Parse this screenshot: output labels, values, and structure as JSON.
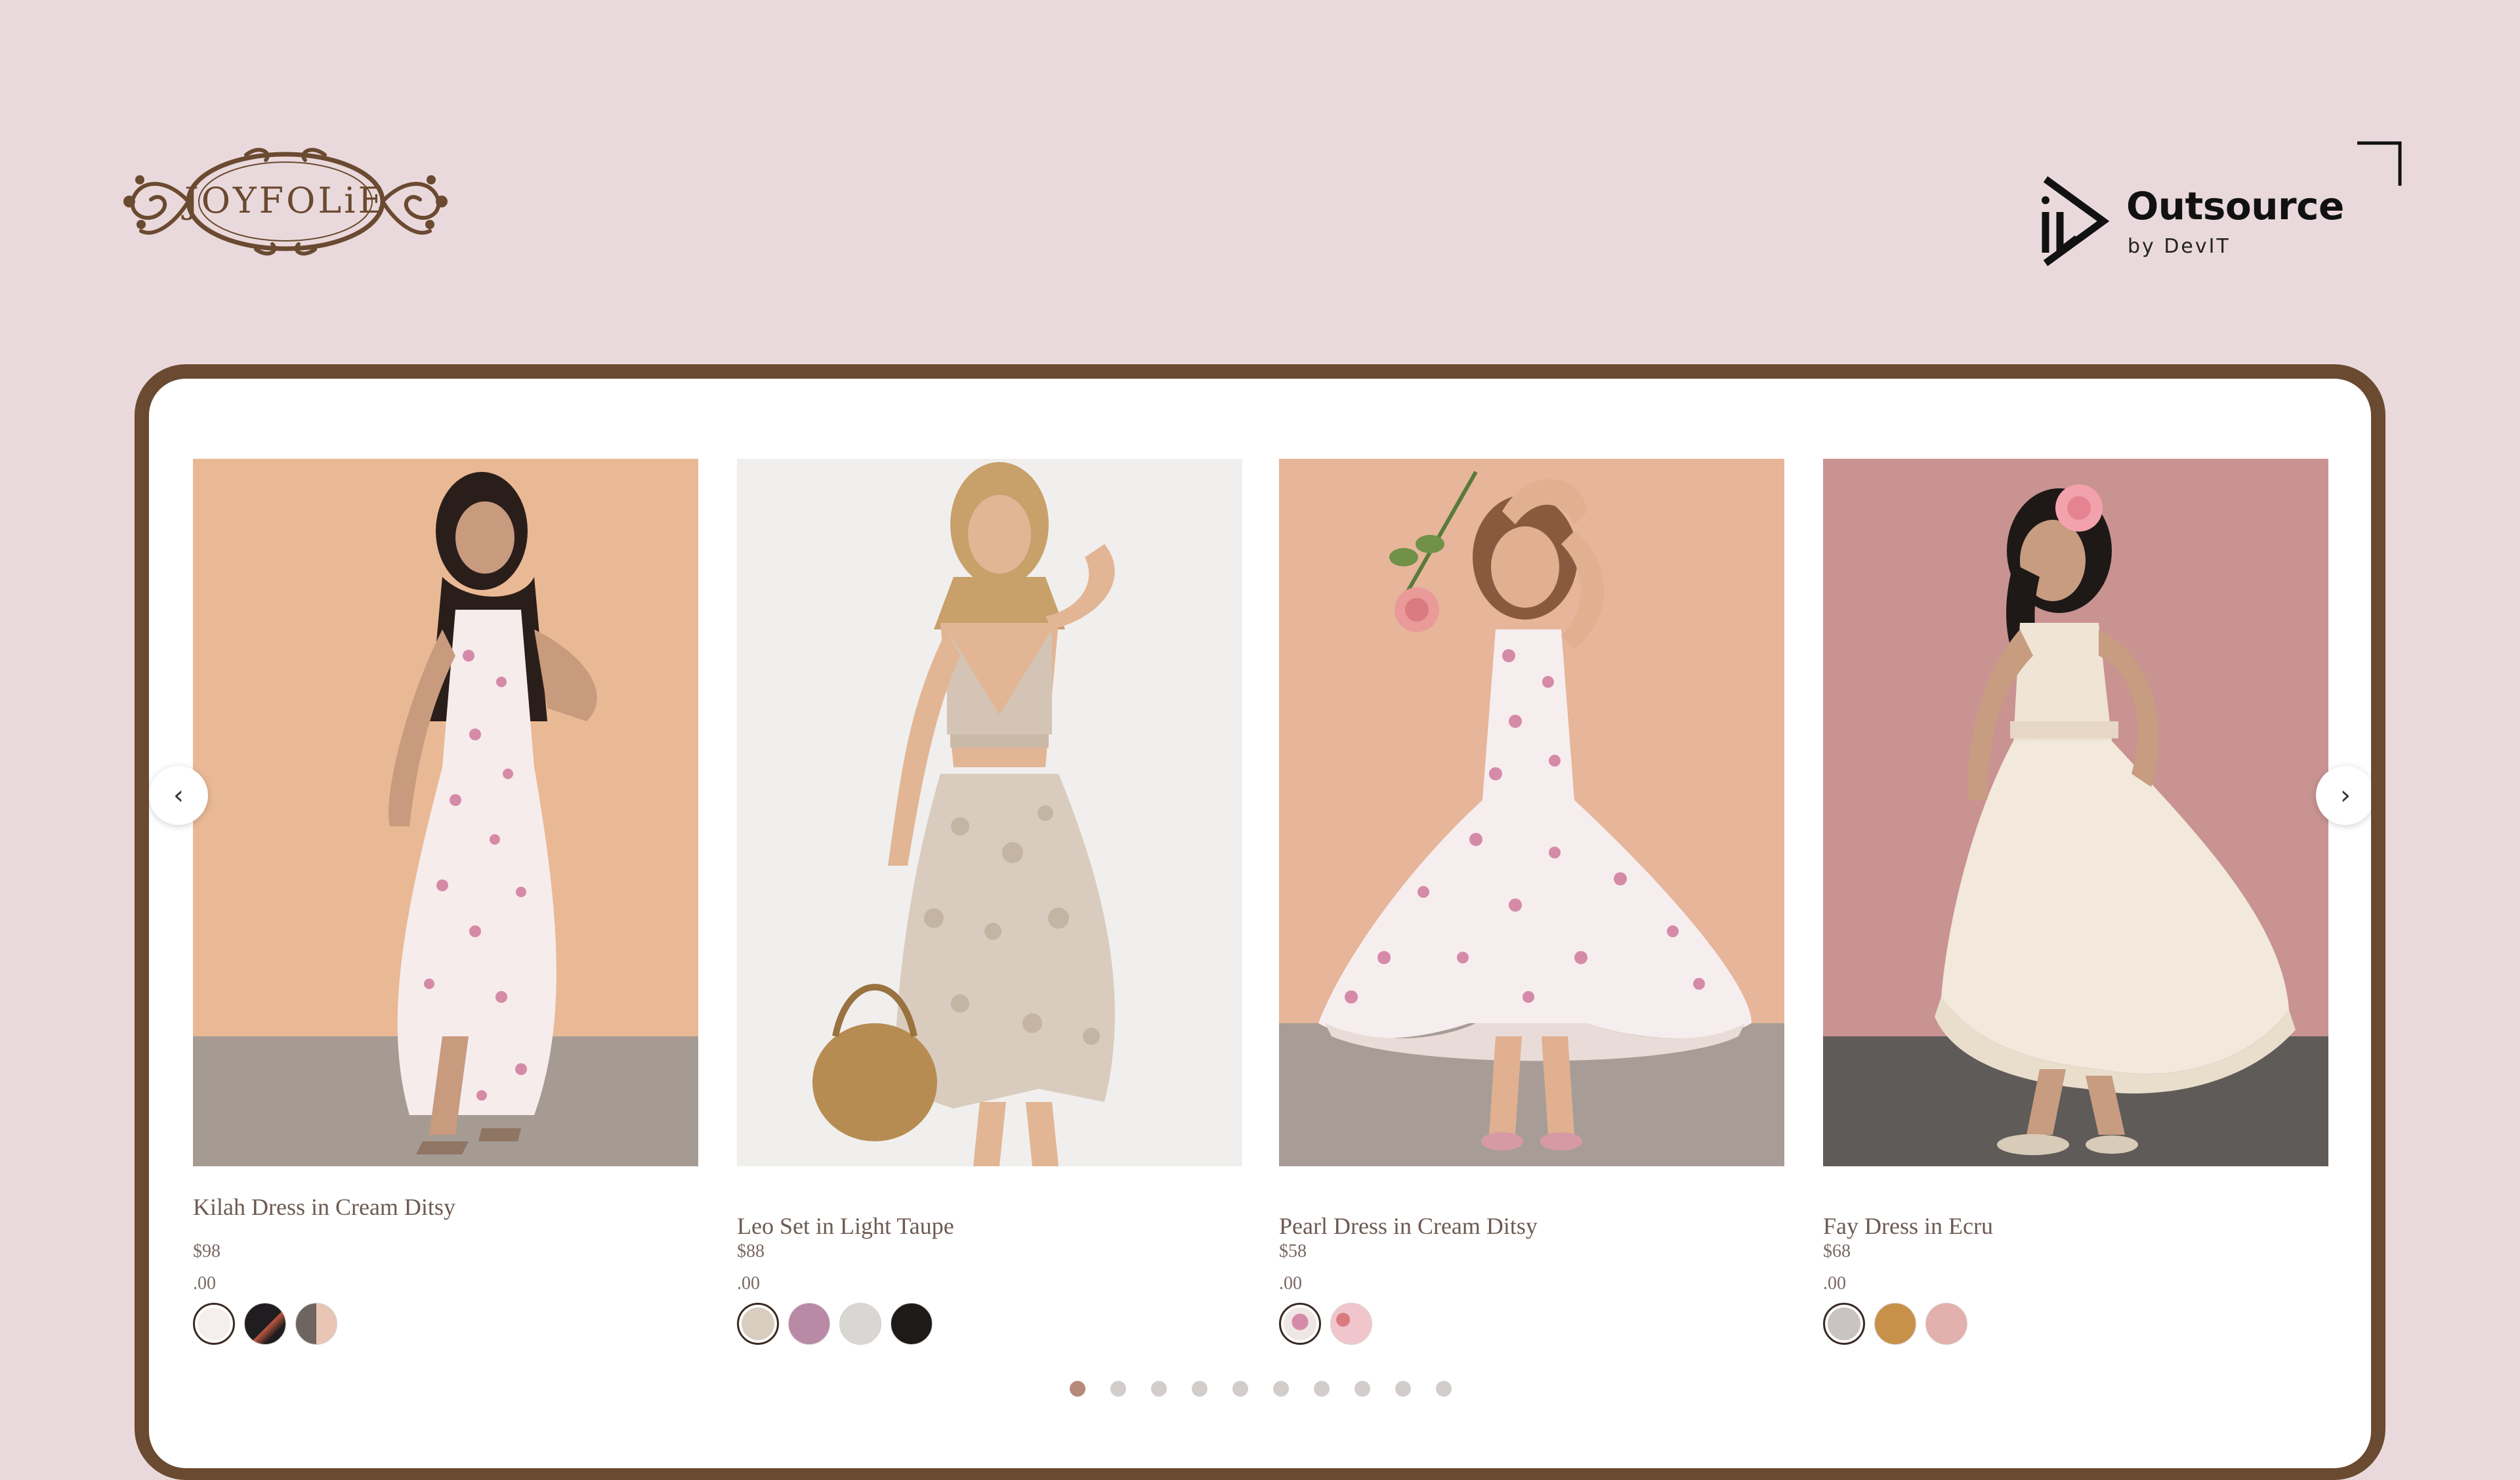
{
  "brand": {
    "logo_text": "JOYFOLiE"
  },
  "sponsor": {
    "name": "Outsource",
    "byline": "by DevIT"
  },
  "carousel": {
    "prev_icon": "chevron-left-icon",
    "next_icon": "chevron-right-icon",
    "prev_label": "‹",
    "next_label": "›",
    "pages": 10,
    "active_page": 1
  },
  "products": [
    {
      "title": "Kilah Dress in Cream Ditsy",
      "price_dollars": "$98",
      "price_cents": ".00",
      "photo_alt": "Woman in a long floral cami dress against a peach wall",
      "swatches": [
        {
          "color": "#f4efec",
          "selected": true
        },
        {
          "color": "#1f1d1f",
          "selected": false
        },
        {
          "color": "#8a7f79",
          "selected": false
        }
      ]
    },
    {
      "title": "Leo Set in Light Taupe",
      "price_dollars": "$88",
      "price_cents": ".00",
      "photo_alt": "Woman in lace bralette and lace skirt holding a straw bag",
      "swatches": [
        {
          "color": "#d9cdbf",
          "selected": true
        },
        {
          "color": "#b88aa6",
          "selected": false
        },
        {
          "color": "#d9d7d4",
          "selected": false
        },
        {
          "color": "#1d1b19",
          "selected": false
        }
      ]
    },
    {
      "title": "Pearl Dress in Cream Ditsy",
      "price_dollars": "$58",
      "price_cents": ".00",
      "photo_alt": "Girl in a floral high-low dress holding a rose",
      "swatches": [
        {
          "color": "#efe6e6",
          "selected": true
        },
        {
          "color": "#f0c6cc",
          "selected": false
        }
      ]
    },
    {
      "title": "Fay Dress in Ecru",
      "price_dollars": "$68",
      "price_cents": ".00",
      "photo_alt": "Girl in a tulle high-low dress with a flower in her hair",
      "swatches": [
        {
          "color": "#c9c4c2",
          "selected": true
        },
        {
          "color": "#c8914a",
          "selected": false
        },
        {
          "color": "#e2b0ad",
          "selected": false
        }
      ]
    }
  ],
  "colors": {
    "page_background": "#ead9dc",
    "frame": "#6a4a30",
    "card_text": "#6d5a52",
    "dot_active": "#b7897a",
    "dot_inactive": "#d2cccb"
  }
}
